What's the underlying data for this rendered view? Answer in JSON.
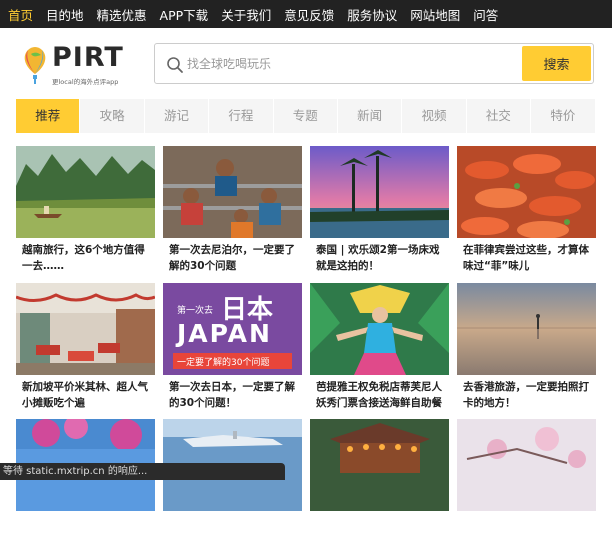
{
  "topnav": [
    {
      "label": "首页",
      "active": true
    },
    {
      "label": "目的地"
    },
    {
      "label": "精选优惠"
    },
    {
      "label": "APP下载"
    },
    {
      "label": "关于我们"
    },
    {
      "label": "意见反馈"
    },
    {
      "label": "服务协议"
    },
    {
      "label": "网站地图"
    },
    {
      "label": "问答"
    }
  ],
  "logo": {
    "name": "PIRT",
    "tagline": "更local的海外点评app"
  },
  "search": {
    "placeholder": "找全球吃喝玩乐",
    "button": "搜索"
  },
  "tabs": [
    "推荐",
    "攻略",
    "游记",
    "行程",
    "专题",
    "新闻",
    "视频",
    "社交",
    "特价"
  ],
  "articles": [
    {
      "title": "越南旅行，这6个地方值得一去……"
    },
    {
      "title": "第一次去尼泊尔，一定要了解的30个问题"
    },
    {
      "title": "泰国 | 欢乐颂2第一场床戏就是这拍的！"
    },
    {
      "title": "在菲律宾尝过这些，才算体味过“菲”味儿"
    },
    {
      "title": "新加坡平价米其林、超人气小摊贩吃个遍"
    },
    {
      "title": "第一次去日本，一定要了解的30个问题！",
      "image_text": [
        "第一次去",
        "日本",
        "JAPAN",
        "一定要了解的30个问题"
      ]
    },
    {
      "title": "芭提雅王权免税店蒂芙尼人妖秀门票含接送海鲜自助餐"
    },
    {
      "title": "去香港旅游，一定要拍照打卡的地方！"
    },
    {
      "title": ""
    },
    {
      "title": ""
    },
    {
      "title": ""
    },
    {
      "title": ""
    }
  ],
  "status": "等待 static.mxtrip.cn 的响应...",
  "colors": {
    "accent": "#ffcc33",
    "topbar": "#222222"
  }
}
